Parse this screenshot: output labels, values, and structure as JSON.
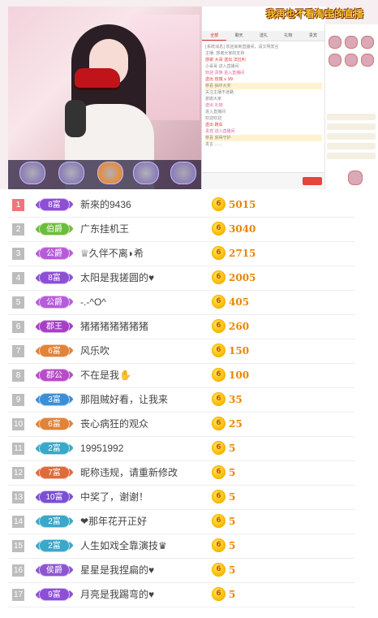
{
  "stream": {
    "banner": "我再也不看淘宝的直播",
    "chat_tabs": [
      "全部",
      "聊天",
      "送礼",
      "礼物",
      "贵宾"
    ],
    "chat_lines": [
      {
        "text": "[系统消息] 欢迎来到直播间，请文明发言",
        "style": "normal"
      },
      {
        "text": "主播: 感谢大家的支持",
        "style": "normal"
      },
      {
        "text": "感谢 大哥 送出 法拉利",
        "style": "red"
      },
      {
        "text": "小哥哥 进入直播间",
        "style": "normal"
      },
      {
        "text": "欢迎 贵族 进入直播间",
        "style": "pink"
      },
      {
        "text": "送出 玫瑰 x 99",
        "style": "red"
      },
      {
        "text": "恭喜 抽中大奖",
        "style": "hl"
      },
      {
        "text": "关注主播不迷路",
        "style": "normal"
      },
      {
        "text": "谢谢大家",
        "style": "normal"
      },
      {
        "text": "送出 礼物",
        "style": "pink"
      },
      {
        "text": "进入直播间",
        "style": "normal"
      },
      {
        "text": "欢迎欢迎",
        "style": "normal"
      },
      {
        "text": "送出 跑车",
        "style": "red"
      },
      {
        "text": "贵宾 进入直播间",
        "style": "pink"
      },
      {
        "text": "恭喜 获得守护",
        "style": "hl"
      },
      {
        "text": "发言 ......",
        "style": "normal"
      }
    ]
  },
  "ranking": [
    {
      "rank": "1",
      "badge": "8富",
      "badge_color": "#8e4fd6",
      "name": "新來的9436",
      "score": "5015"
    },
    {
      "rank": "2",
      "badge": "伯爵",
      "badge_color": "#6bbd3c",
      "name": "广东挂机王",
      "score": "3040"
    },
    {
      "rank": "3",
      "badge": "公爵",
      "badge_color": "#b65cd8",
      "name": "♕久伴不离◗希",
      "score": "2715"
    },
    {
      "rank": "4",
      "badge": "8富",
      "badge_color": "#8e4fd6",
      "name": "太阳是我搓圆的♥",
      "score": "2005"
    },
    {
      "rank": "5",
      "badge": "公爵",
      "badge_color": "#b65cd8",
      "name": "-.-^O^",
      "score": "405"
    },
    {
      "rank": "6",
      "badge": "郡王",
      "badge_color": "#a63fc6",
      "name": "猪猪猪猪猪猪猪",
      "score": "260"
    },
    {
      "rank": "7",
      "badge": "6富",
      "badge_color": "#e2833a",
      "name": "风乐吹",
      "score": "150"
    },
    {
      "rank": "8",
      "badge": "郡公",
      "badge_color": "#b84bc8",
      "name": "不在是我✋",
      "score": "100"
    },
    {
      "rank": "9",
      "badge": "3富",
      "badge_color": "#3c8fd6",
      "name": "那阻贼好看，让我来",
      "score": "35"
    },
    {
      "rank": "10",
      "badge": "6富",
      "badge_color": "#e2833a",
      "name": "丧心病狂的观众",
      "score": "25"
    },
    {
      "rank": "11",
      "badge": "2富",
      "badge_color": "#3aa8c9",
      "name": "19951992",
      "score": "5"
    },
    {
      "rank": "12",
      "badge": "7富",
      "badge_color": "#e06a3c",
      "name": "昵称违规，请重新修改",
      "score": "5"
    },
    {
      "rank": "13",
      "badge": "10富",
      "badge_color": "#7a4fd3",
      "name": "中奖了，谢谢！",
      "score": "5"
    },
    {
      "rank": "14",
      "badge": "2富",
      "badge_color": "#3aa8c9",
      "name": "❤那年花开正好",
      "score": "5"
    },
    {
      "rank": "15",
      "badge": "2富",
      "badge_color": "#3aa8c9",
      "name": "人生如戏全靠演技♛",
      "score": "5"
    },
    {
      "rank": "16",
      "badge": "侯爵",
      "badge_color": "#8d56d0",
      "name": "星星是我捏扁的♥",
      "score": "5"
    },
    {
      "rank": "17",
      "badge": "9富",
      "badge_color": "#8e4fd6",
      "name": "月亮是我踢弯的♥",
      "score": "5"
    }
  ],
  "coin_glyph": "6",
  "colors": {
    "rank_top": "#f2737b",
    "rank_other": "#bdbdbd",
    "score": "#e98500",
    "coin": "#fbc20a"
  }
}
